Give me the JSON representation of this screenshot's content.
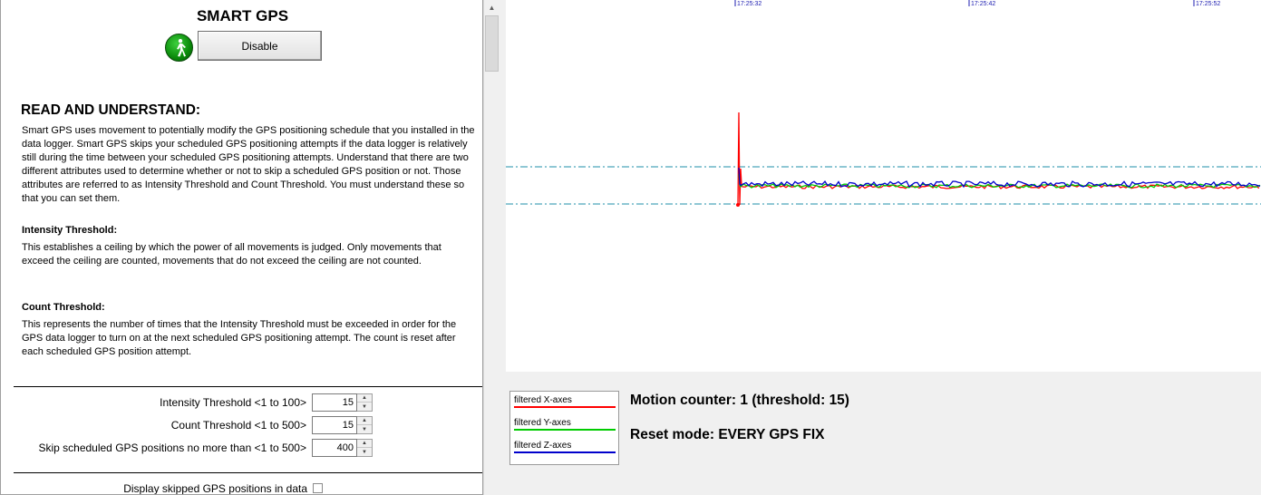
{
  "app": {
    "title": "SMART GPS",
    "disable_button": "Disable",
    "status_icon": "walking-person-icon"
  },
  "instructions": {
    "heading": "READ AND UNDERSTAND:",
    "intro": "Smart GPS uses movement to potentially modify the GPS positioning schedule that you installed in the data logger. Smart GPS skips your scheduled GPS positioning attempts if the data logger is relatively still during the time between your scheduled GPS positioning attempts. Understand that there are two different attributes used to determine whether or not to skip a scheduled GPS position or not. Those attributes are referred to as Intensity Threshold  and Count Threshold. You must understand these so that you can set them.",
    "intensity_heading": "Intensity Threshold:",
    "intensity_text": "This establishes a ceiling by which the power of all movements is judged.  Only movements that exceed the ceiling are counted, movements that do not exceed  the ceiling are not counted.",
    "count_heading": "Count Threshold:",
    "count_text": "This represents the number of times that the Intensity Threshold must be exceeded in order  for the GPS data logger to turn on at the next scheduled GPS positioning attempt. The count is reset after each scheduled GPS position attempt."
  },
  "settings": {
    "intensity_label": "Intensity Threshold <1 to 100>",
    "intensity_value": "15",
    "count_label": "Count Threshold <1 to 500>",
    "count_value": "15",
    "skip_label": "Skip scheduled GPS positions no more than <1 to 500>",
    "skip_value": "400",
    "display_skipped_label": "Display skipped GPS positions in data",
    "display_skipped_checked": false
  },
  "plot": {
    "time_ticks": [
      "17:25:32",
      "17:25:42",
      "17:25:52"
    ],
    "colors": {
      "x": "#ff0000",
      "y": "#00cc00",
      "z": "#0000cc",
      "threshold": "#1f8fa8",
      "tick": "#1c1cb0"
    }
  },
  "legend": {
    "x_label": "filtered X-axes",
    "y_label": "filtered Y-axes",
    "z_label": "filtered Z-axes"
  },
  "status": {
    "motion_counter": "Motion counter: 1 (threshold: 15)",
    "reset_mode": "Reset mode: EVERY GPS FIX"
  }
}
